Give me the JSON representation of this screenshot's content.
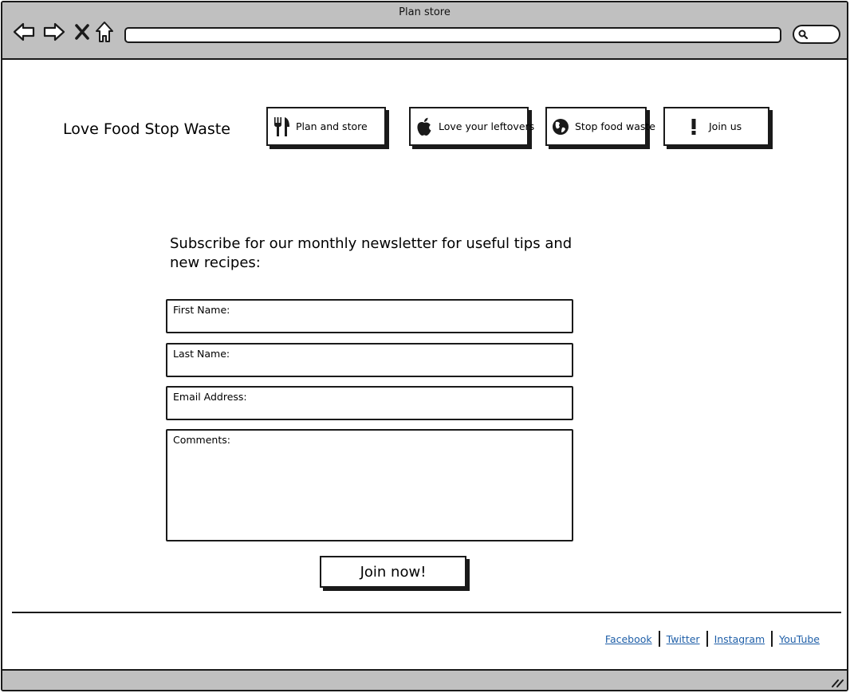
{
  "window": {
    "title": "Plan  store"
  },
  "toolbar": {
    "back_icon": "back-arrow-icon",
    "forward_icon": "forward-arrow-icon",
    "stop_icon": "close-icon",
    "home_icon": "home-icon",
    "address_value": "",
    "search_icon": "search-icon"
  },
  "header": {
    "brand": "Love Food Stop Waste",
    "nav": [
      {
        "label": "Plan and store",
        "icon": "cutlery-icon"
      },
      {
        "label": "Love your leftovers",
        "icon": "apple-icon"
      },
      {
        "label": "Stop food waste",
        "icon": "globe-icon"
      },
      {
        "label": "Join us",
        "icon": "exclamation-icon"
      }
    ]
  },
  "form": {
    "heading": "Subscribe for our monthly newsletter for useful tips and new recipes:",
    "fields": [
      {
        "label": "First Name:",
        "value": ""
      },
      {
        "label": "Last Name:",
        "value": ""
      },
      {
        "label": "Email Address:",
        "value": ""
      },
      {
        "label": "Comments:",
        "value": ""
      }
    ],
    "submit_label": "Join now!"
  },
  "footer": {
    "links": [
      "Facebook",
      "Twitter",
      "Instagram",
      "YouTube"
    ]
  },
  "colors": {
    "chrome": "#c0c0c0",
    "link": "#1f5fa8",
    "stroke": "#1a1a1a"
  }
}
